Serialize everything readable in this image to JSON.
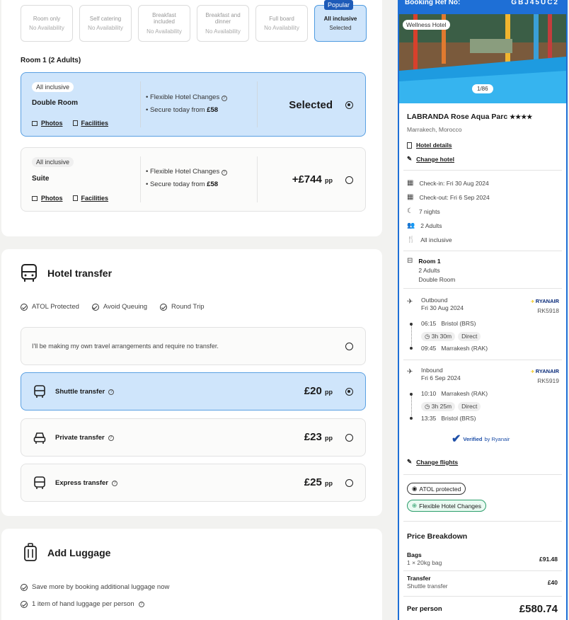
{
  "boards": [
    {
      "name": "Room only",
      "avail": "No Availability"
    },
    {
      "name": "Self catering",
      "avail": "No Availability"
    },
    {
      "name": "Breakfast included",
      "avail": "No Availability"
    },
    {
      "name": "Breakfast and dinner",
      "avail": "No Availability"
    },
    {
      "name": "Full board",
      "avail": "No Availability"
    },
    {
      "name": "All inclusive",
      "avail": "Selected",
      "badge": "Popular"
    }
  ],
  "room": {
    "title": "Room 1 (2 Adults)",
    "options": [
      {
        "board": "All inclusive",
        "name": "Double Room",
        "photos": "Photos",
        "facilities": "Facilities",
        "b1": "Flexible Hotel Changes",
        "b2": "Secure today from",
        "b2v": "£58",
        "price": "Selected",
        "pp": ""
      },
      {
        "board": "All inclusive",
        "name": "Suite",
        "photos": "Photos",
        "facilities": "Facilities",
        "b1": "Flexible Hotel Changes",
        "b2": "Secure today from",
        "b2v": "£58",
        "price": "+£744",
        "pp": "pp"
      }
    ]
  },
  "transfer": {
    "title": "Hotel transfer",
    "features": [
      "ATOL Protected",
      "Avoid Queuing",
      "Round Trip"
    ],
    "none": "I'll be making my own travel arrangements and require no transfer.",
    "options": [
      {
        "name": "Shuttle transfer",
        "price": "£20",
        "pp": "pp"
      },
      {
        "name": "Private transfer",
        "price": "£23",
        "pp": "pp"
      },
      {
        "name": "Express transfer",
        "price": "£25",
        "pp": "pp"
      }
    ]
  },
  "luggage": {
    "title": "Add Luggage",
    "features": [
      "Save more by booking additional luggage now",
      "1 item of hand luggage per person"
    ]
  },
  "summary": {
    "ref_label": "Booking Ref No:",
    "ref": "GBJ45UC2",
    "wellness": "Wellness Hotel",
    "photo_count": "1/86",
    "hotel": "LABRANDA Rose Aqua Parc",
    "stars": "★★★★",
    "location": "Marrakech, Morocco",
    "hotel_details": "Hotel details",
    "change_hotel": "Change hotel",
    "checkin": "Check-in: Fri 30 Aug 2024",
    "checkout": "Check-out: Fri 6 Sep 2024",
    "nights": "7 nights",
    "adults": "2 Adults",
    "board": "All inclusive",
    "room_label": "Room 1",
    "room_adults": "2 Adults",
    "room_type": "Double Room",
    "outbound": {
      "label": "Outbound",
      "date": "Fri 30 Aug 2024",
      "airline": "RYANAIR",
      "flight": "RK5918",
      "dep_time": "06:15",
      "dep": "Bristol (BRS)",
      "duration": "3h 30m",
      "stops": "Direct",
      "arr_time": "09:45",
      "arr": "Marrakesh (RAK)"
    },
    "inbound": {
      "label": "Inbound",
      "date": "Fri 6 Sep 2024",
      "airline": "RYANAIR",
      "flight": "RK5919",
      "dep_time": "10:10",
      "dep": "Marrakesh (RAK)",
      "duration": "3h 25m",
      "stops": "Direct",
      "arr_time": "13:35",
      "arr": "Bristol (BRS)"
    },
    "verified": "Verified",
    "verified_by": "by Ryanair",
    "change_flights": "Change flights",
    "atol": "ATOL protected",
    "flex": "Flexible Hotel Changes",
    "pb_title": "Price Breakdown",
    "bags_label": "Bags",
    "bags_sub": "1 × 20kg bag",
    "bags_value": "£91.48",
    "transfer_label": "Transfer",
    "transfer_sub": "Shuttle transfer",
    "transfer_value": "£40",
    "pp_label": "Per person",
    "pp_value": "£580.74"
  },
  "colors": {
    "accent": "#1e6fd6",
    "selected_bg": "#cfe5fb"
  }
}
